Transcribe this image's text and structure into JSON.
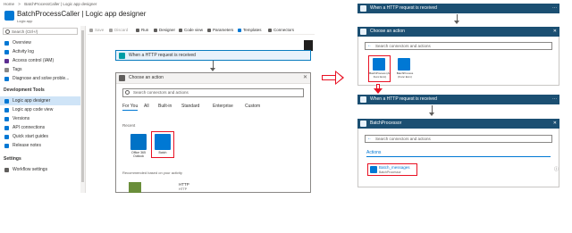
{
  "breadcrumb": [
    "Home",
    ">",
    "BatchProcessCaller | Logic app designer"
  ],
  "app": {
    "title": "BatchProcessCaller | Logic app designer",
    "subtitle": "Logic app"
  },
  "sidebar": {
    "search_placeholder": "Search (Ctrl+/)",
    "items": [
      {
        "label": "Overview",
        "color": "#0078d4"
      },
      {
        "label": "Activity log",
        "color": "#0078d4"
      },
      {
        "label": "Access control (IAM)",
        "color": "#5c2d91"
      },
      {
        "label": "Tags",
        "color": "#8a8886"
      },
      {
        "label": "Diagnose and solve proble...",
        "color": "#0078d4"
      }
    ],
    "section_dev": "Development Tools",
    "dev_items": [
      {
        "label": "Logic app designer",
        "color": "#0078d4",
        "selected": true
      },
      {
        "label": "Logic app code view",
        "color": "#0078d4"
      },
      {
        "label": "Versions",
        "color": "#0078d4"
      },
      {
        "label": "API connections",
        "color": "#0078d4"
      },
      {
        "label": "Quick start guides",
        "color": "#0078d4"
      },
      {
        "label": "Release notes",
        "color": "#0078d4"
      }
    ],
    "section_settings": "Settings",
    "settings_items": [
      {
        "label": "Workflow settings",
        "color": "#605e5c"
      }
    ]
  },
  "toolbar": {
    "items": [
      "Save",
      "Discard",
      "Run",
      "Designer",
      "Code view",
      "Parameters",
      "Templates",
      "Connectors"
    ]
  },
  "designer": {
    "trigger_title": "When a HTTP request is received",
    "action_title": "Choose an action",
    "search_placeholder": "Search connectors and actions",
    "tabs": [
      "For You",
      "All",
      "Built-in",
      "Standard",
      "Enterprise",
      "Custom"
    ],
    "recent_label": "Recent",
    "recent_tiles": [
      {
        "label": "Office 365 Outlook",
        "color": "#0072c6"
      },
      {
        "label": "Batch",
        "color": "#0078d4"
      }
    ],
    "recommended_label": "Recommended based on your activity",
    "http_label": "HTTP",
    "http_sub": "HTTP"
  },
  "right_top": {
    "trigger_title": "When a HTTP request is received",
    "action_title": "Choose an action",
    "search_placeholder": "Search connectors and actions",
    "tiles": [
      {
        "label": "BatchProcess (Az Func Exm)",
        "color": "#0078d4"
      },
      {
        "label": "BatchProcess (Func Exm)",
        "color": "#0078d4"
      }
    ]
  },
  "right_bottom": {
    "trigger_title": "When a HTTP request is received",
    "connector_title": "BatchProcessor",
    "search_placeholder": "Search connectors and actions",
    "actions_label": "Actions",
    "action_name": "Batch_messages",
    "action_sub": "BatchProcessor"
  }
}
